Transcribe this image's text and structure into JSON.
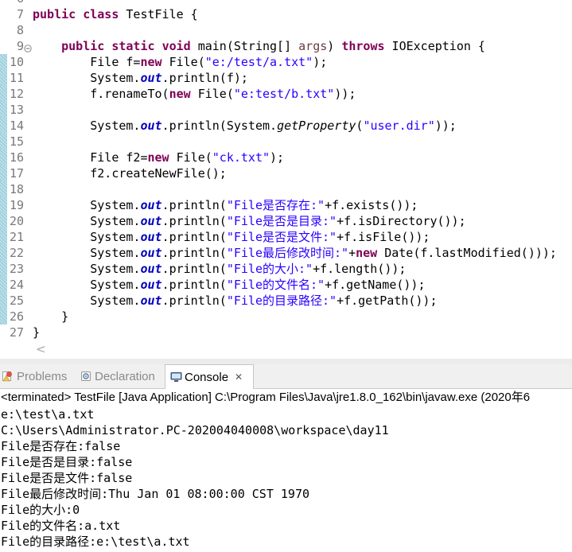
{
  "editor": {
    "lines": [
      {
        "num": "6",
        "tokens": []
      },
      {
        "num": "7",
        "tokens": [
          {
            "v": "public",
            "col": "#7F0055",
            "b": true
          },
          {
            "v": " "
          },
          {
            "v": "class",
            "col": "#7F0055",
            "b": true
          },
          {
            "v": " TestFile {"
          }
        ]
      },
      {
        "num": "8",
        "tokens": []
      },
      {
        "num": "9",
        "fold": true,
        "tokens": [
          {
            "v": "    "
          },
          {
            "v": "public",
            "col": "#7F0055",
            "b": true
          },
          {
            "v": " "
          },
          {
            "v": "static",
            "col": "#7F0055",
            "b": true
          },
          {
            "v": " "
          },
          {
            "v": "void",
            "col": "#7F0055",
            "b": true
          },
          {
            "v": " main(String[] "
          },
          {
            "v": "args",
            "col": "#6A3E3E"
          },
          {
            "v": ") "
          },
          {
            "v": "throws",
            "col": "#7F0055",
            "b": true
          },
          {
            "v": " IOException {"
          }
        ]
      },
      {
        "num": "10",
        "changed": true,
        "tokens": [
          {
            "v": "        File f="
          },
          {
            "v": "new",
            "col": "#7F0055",
            "b": true
          },
          {
            "v": " File("
          },
          {
            "v": "\"e:/test/a.txt\"",
            "col": "#2A00FF"
          },
          {
            "v": ");"
          }
        ]
      },
      {
        "num": "11",
        "changed": true,
        "tokens": [
          {
            "v": "        System."
          },
          {
            "v": "out",
            "col": "#0000C0",
            "b": true,
            "i": true
          },
          {
            "v": ".println(f);"
          }
        ]
      },
      {
        "num": "12",
        "changed": true,
        "tokens": [
          {
            "v": "        f.renameTo("
          },
          {
            "v": "new",
            "col": "#7F0055",
            "b": true
          },
          {
            "v": " File("
          },
          {
            "v": "\"e:test/b.txt\"",
            "col": "#2A00FF"
          },
          {
            "v": "));"
          }
        ]
      },
      {
        "num": "13",
        "changed": true,
        "tokens": []
      },
      {
        "num": "14",
        "changed": true,
        "tokens": [
          {
            "v": "        System."
          },
          {
            "v": "out",
            "col": "#0000C0",
            "b": true,
            "i": true
          },
          {
            "v": ".println(System."
          },
          {
            "v": "getProperty",
            "i": true
          },
          {
            "v": "("
          },
          {
            "v": "\"user.dir\"",
            "col": "#2A00FF"
          },
          {
            "v": "));"
          }
        ]
      },
      {
        "num": "15",
        "changed": true,
        "tokens": []
      },
      {
        "num": "16",
        "changed": true,
        "tokens": [
          {
            "v": "        File f2="
          },
          {
            "v": "new",
            "col": "#7F0055",
            "b": true
          },
          {
            "v": " File("
          },
          {
            "v": "\"ck.txt\"",
            "col": "#2A00FF"
          },
          {
            "v": ");"
          }
        ]
      },
      {
        "num": "17",
        "changed": true,
        "tokens": [
          {
            "v": "        f2.createNewFile();"
          }
        ]
      },
      {
        "num": "18",
        "changed": true,
        "tokens": []
      },
      {
        "num": "19",
        "changed": true,
        "tokens": [
          {
            "v": "        System."
          },
          {
            "v": "out",
            "col": "#0000C0",
            "b": true,
            "i": true
          },
          {
            "v": ".println("
          },
          {
            "v": "\"File是否存在:\"",
            "col": "#2A00FF"
          },
          {
            "v": "+f.exists());"
          }
        ]
      },
      {
        "num": "20",
        "changed": true,
        "tokens": [
          {
            "v": "        System."
          },
          {
            "v": "out",
            "col": "#0000C0",
            "b": true,
            "i": true
          },
          {
            "v": ".println("
          },
          {
            "v": "\"File是否是目录:\"",
            "col": "#2A00FF"
          },
          {
            "v": "+f.isDirectory());"
          }
        ]
      },
      {
        "num": "21",
        "changed": true,
        "tokens": [
          {
            "v": "        System."
          },
          {
            "v": "out",
            "col": "#0000C0",
            "b": true,
            "i": true
          },
          {
            "v": ".println("
          },
          {
            "v": "\"File是否是文件:\"",
            "col": "#2A00FF"
          },
          {
            "v": "+f.isFile());"
          }
        ]
      },
      {
        "num": "22",
        "changed": true,
        "tokens": [
          {
            "v": "        System."
          },
          {
            "v": "out",
            "col": "#0000C0",
            "b": true,
            "i": true
          },
          {
            "v": ".println("
          },
          {
            "v": "\"File最后修改时间:\"",
            "col": "#2A00FF"
          },
          {
            "v": "+"
          },
          {
            "v": "new",
            "col": "#7F0055",
            "b": true
          },
          {
            "v": " Date(f.lastModified()));"
          }
        ]
      },
      {
        "num": "23",
        "changed": true,
        "tokens": [
          {
            "v": "        System."
          },
          {
            "v": "out",
            "col": "#0000C0",
            "b": true,
            "i": true
          },
          {
            "v": ".println("
          },
          {
            "v": "\"File的大小:\"",
            "col": "#2A00FF"
          },
          {
            "v": "+f.length());"
          }
        ]
      },
      {
        "num": "24",
        "changed": true,
        "tokens": [
          {
            "v": "        System."
          },
          {
            "v": "out",
            "col": "#0000C0",
            "b": true,
            "i": true
          },
          {
            "v": ".println("
          },
          {
            "v": "\"File的文件名:\"",
            "col": "#2A00FF"
          },
          {
            "v": "+f.getName());"
          }
        ]
      },
      {
        "num": "25",
        "changed": true,
        "tokens": [
          {
            "v": "        System."
          },
          {
            "v": "out",
            "col": "#0000C0",
            "b": true,
            "i": true
          },
          {
            "v": ".println("
          },
          {
            "v": "\"File的目录路径:\"",
            "col": "#2A00FF"
          },
          {
            "v": "+f.getPath());"
          }
        ]
      },
      {
        "num": "26",
        "changed": true,
        "tokens": [
          {
            "v": "    }"
          }
        ]
      },
      {
        "num": "27",
        "tokens": [
          {
            "v": "}"
          }
        ]
      }
    ],
    "scroll_left": "<"
  },
  "panel": {
    "tabs": [
      {
        "label": "Problems",
        "icon": "problems-icon",
        "active": false
      },
      {
        "label": "Declaration",
        "icon": "declaration-icon",
        "active": false
      },
      {
        "label": "Console",
        "icon": "console-icon",
        "active": true
      }
    ],
    "close_glyph": "✕",
    "console": {
      "header": "<terminated> TestFile [Java Application] C:\\Program Files\\Java\\jre1.8.0_162\\bin\\javaw.exe (2020年6",
      "output": [
        "e:\\test\\a.txt",
        "C:\\Users\\Administrator.PC-202004040008\\workspace\\day11",
        "File是否存在:false",
        "File是否是目录:false",
        "File是否是文件:false",
        "File最后修改时间:Thu Jan 01 08:00:00 CST 1970",
        "File的大小:0",
        "File的文件名:a.txt",
        "File的目录路径:e:\\test\\a.txt"
      ]
    }
  }
}
